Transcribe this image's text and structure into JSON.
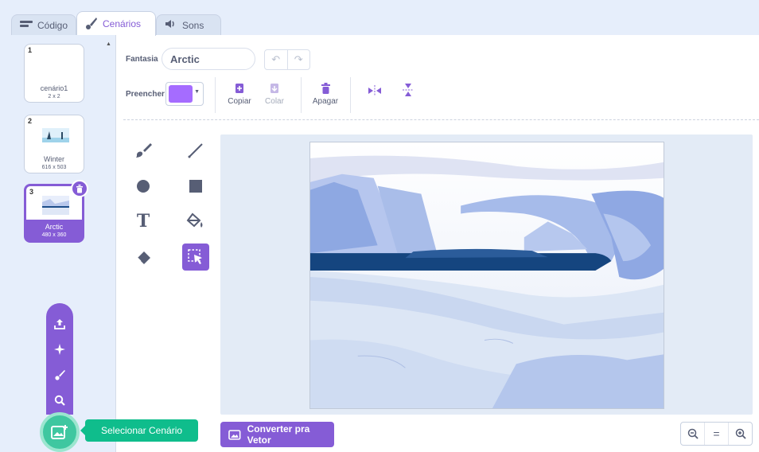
{
  "tabs": [
    {
      "label": "Código",
      "icon": "code-icon"
    },
    {
      "label": "Cenários",
      "icon": "brush-icon",
      "active": true
    },
    {
      "label": "Sons",
      "icon": "speaker-icon"
    }
  ],
  "costumes": [
    {
      "number": "1",
      "name": "cenário1",
      "size": "2 x 2"
    },
    {
      "number": "2",
      "name": "Winter",
      "size": "616 x 503"
    },
    {
      "number": "3",
      "name": "Arctic",
      "size": "480 x 360",
      "selected": true
    }
  ],
  "toolbar": {
    "name_label": "Fantasia",
    "name_value": "Arctic",
    "fill_label": "Preencher",
    "fill_color": "#a56cff",
    "copy_label": "Copiar",
    "paste_label": "Colar",
    "delete_label": "Apagar"
  },
  "fab": {
    "tooltip": "Selecionar Cenário",
    "items": [
      "upload-icon",
      "surprise-icon",
      "paint-icon",
      "search-icon"
    ]
  },
  "convert_button": "Converter pra Vetor",
  "zoom": {
    "out": "−",
    "reset": "=",
    "in": "+"
  },
  "colors": {
    "accent": "#855cd6",
    "extension_green": "#0fbd8c",
    "sidebar_bg": "#e6eefb"
  }
}
